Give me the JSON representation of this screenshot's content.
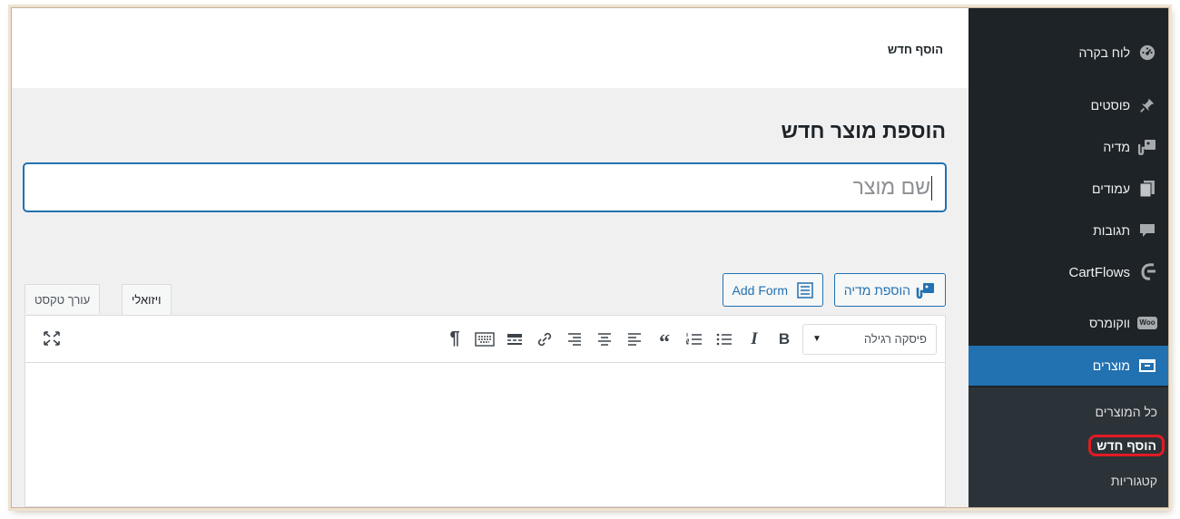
{
  "header": {
    "title": "הוסף חדש"
  },
  "sidebar": {
    "items": [
      {
        "label": "לוח בקרה",
        "icon": "dashboard-icon"
      },
      {
        "label": "פוסטים",
        "icon": "pin-icon"
      },
      {
        "label": "מדיה",
        "icon": "media-icon"
      },
      {
        "label": "עמודים",
        "icon": "pages-icon"
      },
      {
        "label": "תגובות",
        "icon": "comments-icon"
      },
      {
        "label": "CartFlows",
        "icon": "cartflows-icon"
      },
      {
        "label": "ווקומרס",
        "icon": "woocommerce-icon",
        "badge": "Woo"
      },
      {
        "label": "מוצרים",
        "icon": "products-icon"
      }
    ],
    "submenu": [
      {
        "label": "כל המוצרים"
      },
      {
        "label": "הוסף חדש"
      },
      {
        "label": "קטגוריות"
      }
    ]
  },
  "main": {
    "page_title": "הוספת מוצר חדש",
    "title_placeholder": "שם מוצר",
    "add_media_label": "הוספת מדיה",
    "add_form_label": "Add Form",
    "tabs": [
      {
        "label": "ויזואלי"
      },
      {
        "label": "עורך טקסט"
      }
    ],
    "format_select": "פיסקה רגילה"
  },
  "colors": {
    "sidebar": "#1d2327",
    "accent": "#2271b1",
    "highlight": "#e21b23"
  }
}
